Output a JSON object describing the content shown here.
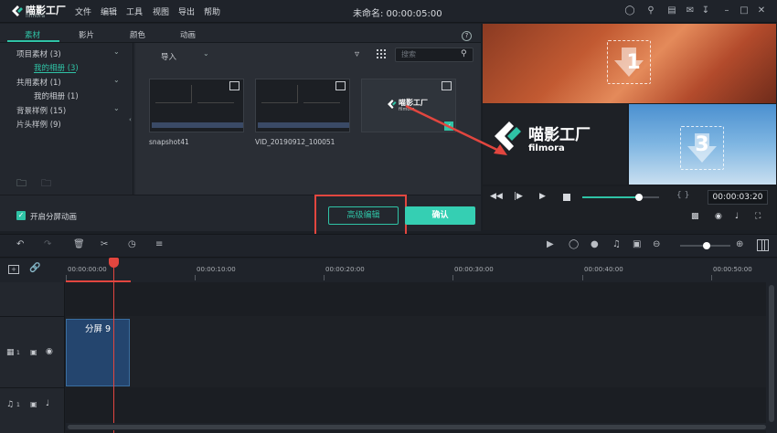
{
  "app": {
    "logo": "喵影工厂",
    "logo_sub": "filmora"
  },
  "menu": [
    "文件",
    "编辑",
    "工具",
    "视图",
    "导出",
    "帮助"
  ],
  "window_title": "未命名: 00:00:05:00",
  "tabs": [
    "素材",
    "影片",
    "颜色",
    "动画"
  ],
  "tree": [
    {
      "label": "项目素材 (3)"
    },
    {
      "label": "我的相册 (3)"
    },
    {
      "label": "共用素材 (1)"
    },
    {
      "label": "我的相册 (1)"
    },
    {
      "label": "背景样例 (15)"
    },
    {
      "label": "片头样例 (9)"
    }
  ],
  "media": {
    "import_label": "导入",
    "search_placeholder": "搜索",
    "items": [
      {
        "name": "snapshot41"
      },
      {
        "name": "VID_20190912_100051"
      },
      {
        "name": ""
      }
    ],
    "thumb3_brand": "喵影工厂",
    "thumb3_sub": "filmora"
  },
  "bottom": {
    "split_anim_label": "开启分屏动画",
    "advanced_label": "高级编辑",
    "confirm_label": "确认"
  },
  "preview": {
    "brand": "喵影工厂",
    "brand_sub": "filmora",
    "num1": "1",
    "num3": "3",
    "timecode": "00:00:03:20",
    "brackets": "{ }",
    "progress": 0.74
  },
  "ruler": [
    "00:00:00:00",
    "00:00:10:00",
    "00:00:20:00",
    "00:00:30:00",
    "00:00:40:00",
    "00:00:50:00"
  ],
  "clip": {
    "label": "分屏 9"
  },
  "tracks": {
    "video_num": "1",
    "audio_num": "1"
  },
  "colors": {
    "accent": "#2fc3a6",
    "highlight": "#e2463f",
    "clip": "#24456e"
  }
}
